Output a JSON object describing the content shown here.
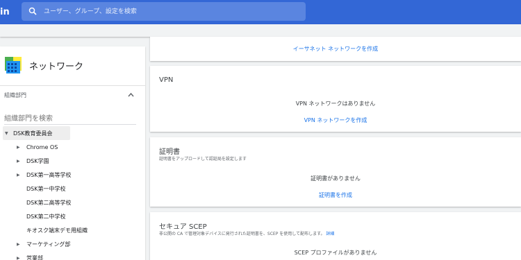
{
  "header": {
    "brand_fragment": "in",
    "search_placeholder": "ユーザー、グループ、設定を検索"
  },
  "sidebar": {
    "title": "ネットワーク",
    "section_label": "組織部門",
    "org_search_placeholder": "組織部門を検索",
    "tree": {
      "root": "DSK教育委員会",
      "children": [
        {
          "label": "Chrome OS",
          "expandable": true
        },
        {
          "label": "DSK学園",
          "expandable": true
        },
        {
          "label": "DSK第一高等学校",
          "expandable": true
        },
        {
          "label": "DSK第一中学校",
          "expandable": false
        },
        {
          "label": "DSK第二高等学校",
          "expandable": false
        },
        {
          "label": "DSK第二中学校",
          "expandable": false
        },
        {
          "label": "キオスク端末デモ用組織",
          "expandable": false
        },
        {
          "label": "マーケティング部",
          "expandable": true
        },
        {
          "label": "営業部",
          "expandable": true
        }
      ]
    }
  },
  "cards": {
    "ethernet": {
      "create_link": "イーサネット ネットワークを作成"
    },
    "vpn": {
      "title": "VPN",
      "empty_text": "VPN ネットワークはありません",
      "create_link": "VPN ネットワークを作成"
    },
    "certificates": {
      "title": "証明書",
      "description": "証明書をアップロードして認証局を設定します",
      "empty_text": "証明書がありません",
      "create_link": "証明書を作成"
    },
    "scep": {
      "title": "セキュア SCEP",
      "description": "非公開の CA で管理対象デバイスに発行された証明書を、SCEP を使用して配布します。",
      "details_link": "詳細",
      "empty_text": "SCEP プロファイルがありません"
    }
  },
  "colors": {
    "topbar": "#3367d6",
    "search_bg": "#5a85e0",
    "link": "#1a73e8",
    "page_bg": "#f1f3f4"
  }
}
